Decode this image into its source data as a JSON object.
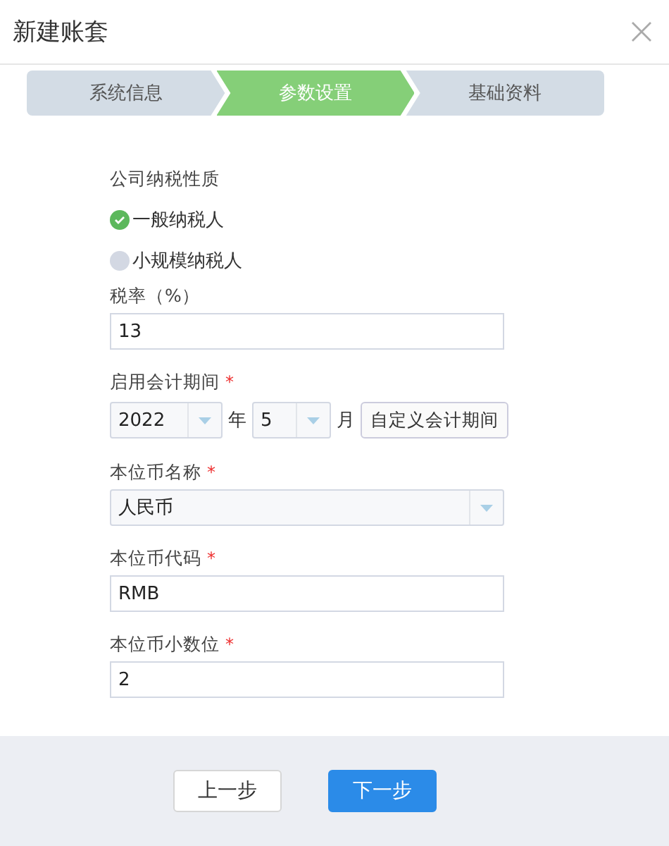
{
  "dialog": {
    "title": "新建账套"
  },
  "steps": [
    {
      "label": "系统信息",
      "selected": false
    },
    {
      "label": "参数设置",
      "selected": true
    },
    {
      "label": "基础资料",
      "selected": false
    }
  ],
  "tax_type": {
    "label": "公司纳税性质",
    "options": [
      {
        "label": "一般纳税人",
        "selected": true
      },
      {
        "label": "小规模纳税人",
        "selected": false
      }
    ]
  },
  "fields": [
    {
      "kind": "text",
      "label": "税率（%）",
      "value": "13"
    },
    {
      "kind": "period",
      "label": "启用会计期间",
      "required_mark": "*",
      "year": "2022",
      "year_unit": "年",
      "month": "5",
      "month_unit": "月",
      "button": "自定义会计期间"
    },
    {
      "kind": "select",
      "label": "本位币名称",
      "required_mark": "*",
      "value": "人民币"
    },
    {
      "kind": "text",
      "label": "本位币代码",
      "required_mark": "*",
      "value": "RMB"
    },
    {
      "kind": "text",
      "label": "本位币小数位",
      "required_mark": "*",
      "value": "2"
    }
  ],
  "footer_buttons": [
    {
      "label": "上一步",
      "kind": "secondary"
    },
    {
      "label": "下一步",
      "kind": "primary"
    }
  ]
}
